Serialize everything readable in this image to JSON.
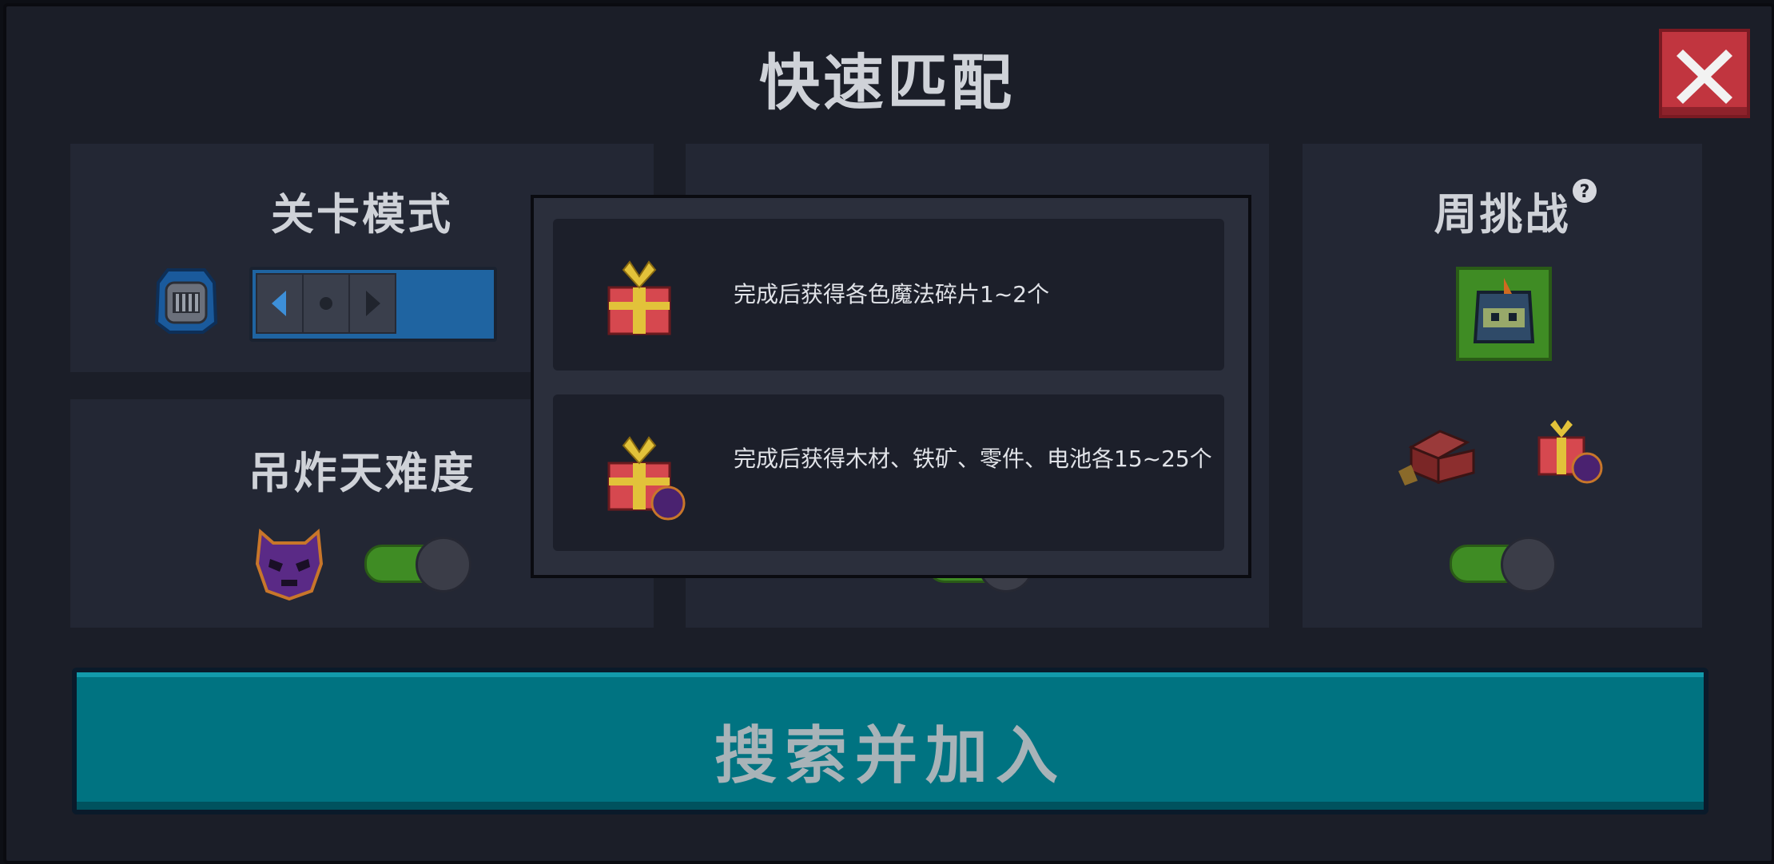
{
  "title": "快速匹配",
  "panels": {
    "level_mode": {
      "title": "关卡模式"
    },
    "difficulty": {
      "title": "吊炸天难度",
      "toggle_on": true
    },
    "middle": {
      "title": ""
    },
    "weekly": {
      "title": "周挑战",
      "toggle_on": true
    }
  },
  "popup": {
    "rewards": [
      {
        "icon": "gift-icon",
        "text": "完成后获得各色魔法碎片1~2个"
      },
      {
        "icon": "gift-demon-icon",
        "text": "完成后获得木材、铁矿、零件、电池各15~25个"
      }
    ]
  },
  "search_button": {
    "label": "搜索并加入"
  },
  "colors": {
    "accent": "#007381",
    "close": "#c1353f",
    "toggle_on": "#3f8c24",
    "stepper": "#1f64a1"
  }
}
